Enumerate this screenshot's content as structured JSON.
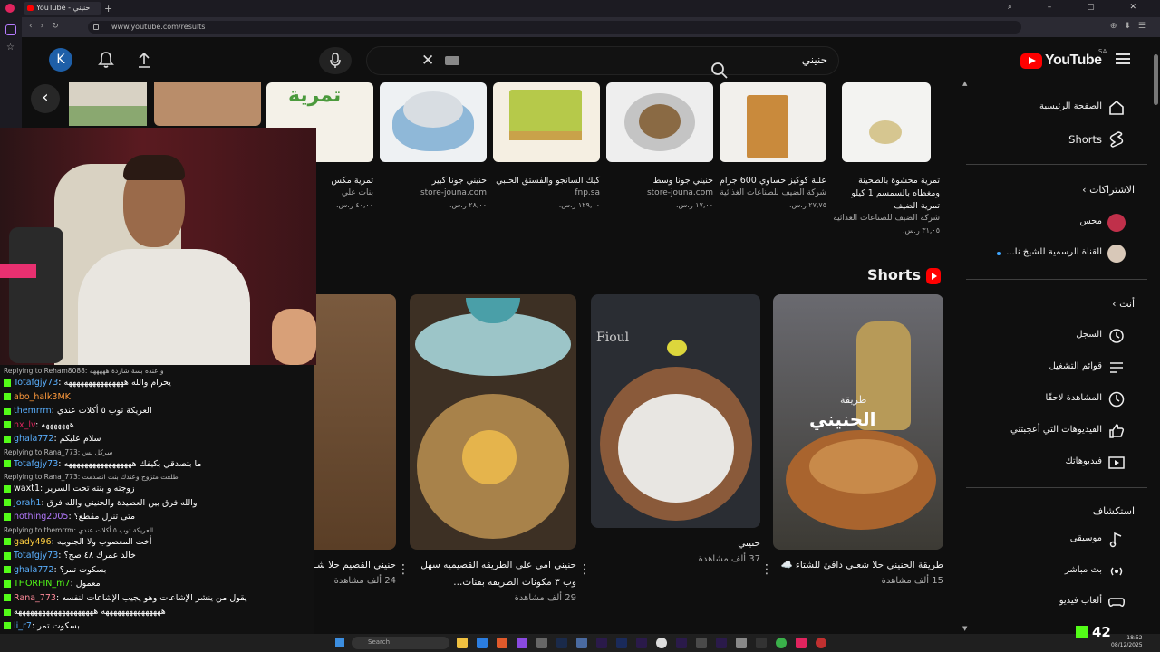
{
  "browser": {
    "tab_title": "YouTube - حنيني",
    "url": "www.youtube.com/results"
  },
  "header": {
    "avatar_letter": "K",
    "search_query": "حنيني",
    "logo_text": "YouTube",
    "logo_region": "SA"
  },
  "products": [
    {
      "title": "تمرية مكس",
      "store": "بنات علي",
      "price": "٤٠,٠٠ ر.س."
    },
    {
      "title": "حنيني جونا كبير",
      "store": "store-jouna.com",
      "price": "٢٨,٠٠ ر.س."
    },
    {
      "title": "كيك السانجو والفستق الحلبي",
      "store": "fnp.sa",
      "price": "١٢٩,٠٠ ر.س."
    },
    {
      "title": "حنيني جونا وسط",
      "store": "store-jouna.com",
      "price": "١٧,٠٠ ر.س."
    },
    {
      "title": "علبة كوكيز حساوي 600 جرام",
      "store": "شركة الضيف للصناعات الغذائية",
      "price": "٢٧,٧٥ ر.س."
    },
    {
      "title": "تمرية محشوة بالطحينة ومغطاه بالسمسم 1 كيلو تمرية الضيف",
      "store": "شركة الضيف للصناعات الغذائية",
      "price": "٣١,٠٥ ر.س."
    }
  ],
  "product_badge_text": "تمرية",
  "shorts": {
    "heading": "Shorts",
    "items": [
      {
        "title": "حنيني القصيم حلا شـ وسهل",
        "views": "24 ألف مشاهدة"
      },
      {
        "title": "حنيني امي على الطريقه القصيميه سهل وب ٣ مكونات الطريقه بقنات...",
        "views": "29 ألف مشاهدة"
      },
      {
        "title": "حنيني",
        "views": "37 ألف مشاهدة"
      },
      {
        "title": "طريقة الحنيني حلا شعبي دافئ للشتاء ☁️",
        "views": "15 ألف مشاهدة"
      }
    ],
    "overlay_text_1": "طريقة",
    "overlay_text_2": "الحنيني",
    "overlay_text_3": "Fioul"
  },
  "sidebar": {
    "home": "الصفحة الرئيسية",
    "shorts": "Shorts",
    "subs_heading": "الاشتراكات",
    "subs": [
      {
        "label": "محس"
      },
      {
        "label": "القناة الرسمية للشيخ نا..."
      }
    ],
    "you_heading": "أنت",
    "you_items": [
      {
        "label": "السجل"
      },
      {
        "label": "قوائم التشغيل"
      },
      {
        "label": "المشاهدة لاحقًا"
      },
      {
        "label": "الفيديوهات التي أعجبتني"
      },
      {
        "label": "فيديوهاتك"
      }
    ],
    "explore_heading": "استكشاف",
    "explore_items": [
      {
        "label": "موسيقى"
      },
      {
        "label": "بث مباشر"
      },
      {
        "label": "ألعاب فيديو"
      }
    ]
  },
  "chat": {
    "lines": [
      {
        "type": "reply",
        "text": "Replying to Reham8088: و عنده بسة شاردة هههههه"
      },
      {
        "type": "msg",
        "user": "Totafgjy73",
        "color": "#5ab0ff",
        "text": "يحرام والله هههههههههههههههه"
      },
      {
        "type": "msg",
        "user": "abo_halk3MK",
        "color": "#ff9a3c",
        "text": ""
      },
      {
        "type": "msg",
        "user": "themrrm",
        "color": "#5ab0ff",
        "text": "العريكة توب ٥ أكلات عندي"
      },
      {
        "type": "msg",
        "user": "nx_lv",
        "color": "#e0245e",
        "text": "هههههههه"
      },
      {
        "type": "msg",
        "user": "ghala772",
        "color": "#5ab0ff",
        "text": "سلام عليكم"
      },
      {
        "type": "reply",
        "text": "Replying to Rana_773: سركل بس"
      },
      {
        "type": "msg",
        "user": "Totafgjy73",
        "color": "#5ab0ff",
        "text": "ما بتصدقي بكيفك هههههههههههههههههه"
      },
      {
        "type": "reply",
        "text": "Replying to Rana_773: طلعت متزوج وعندك بنت انصدمت"
      },
      {
        "type": "msg",
        "user": "waxt1",
        "color": "#ffffff",
        "text": "زوجته و بنته تحت السرير"
      },
      {
        "type": "msg",
        "user": "Jorah1",
        "color": "#5ab0ff",
        "text": "والله فرق بين العصيدة والحنيني والله فرق"
      },
      {
        "type": "msg",
        "user": "nothing2005",
        "color": "#b57bff",
        "text": "متى تنزل مقطع؟"
      },
      {
        "type": "reply",
        "text": "Replying to themrrm: العريكة توب ٥ أكلات عندي"
      },
      {
        "type": "msg",
        "user": "gady496",
        "color": "#ffcf40",
        "text": "أخت المعصوب ولا الجنوبيه"
      },
      {
        "type": "msg",
        "user": "Totafgjy73",
        "color": "#5ab0ff",
        "text": "خالد عمرك ٤٨ صح؟"
      },
      {
        "type": "msg",
        "user": "ghala772",
        "color": "#5ab0ff",
        "text": "بسكوت تمر؟"
      },
      {
        "type": "msg",
        "user": "THORFIN_m7",
        "color": "#53fc18",
        "text": "معمول"
      },
      {
        "type": "msg",
        "user": "Rana_773",
        "color": "#ff8a9a",
        "text": "يقول من ينشر الإشاعات وهو يجيب الإشاعات لنفسه"
      },
      {
        "type": "msg",
        "user": "",
        "color": "#ffffff",
        "text": "هههههههههههههههه ههههههههههههههههههههه"
      },
      {
        "type": "msg",
        "user": "li_r7",
        "color": "#5ab0ff",
        "text": "بسكوت تمر"
      }
    ]
  },
  "taskbar": {
    "search_placeholder": "Search",
    "time": "18:52",
    "date": "08/12/2025"
  },
  "kick": {
    "viewer_count": "42"
  },
  "colors": {
    "bg": "#0f0f0f",
    "yt_red": "#ff0000",
    "kick_green": "#53fc18"
  }
}
